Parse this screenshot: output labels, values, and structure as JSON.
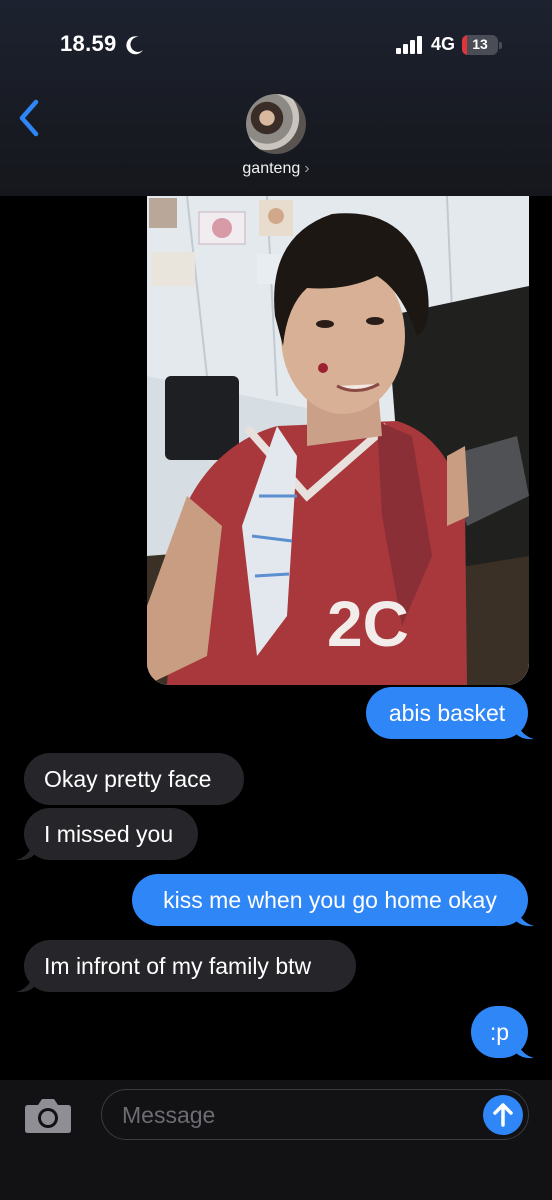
{
  "status": {
    "time": "18.59",
    "network": "4G",
    "battery": "13",
    "battery_level": 0.13
  },
  "contact": {
    "name": "ganteng",
    "chevron": "›"
  },
  "icons": {
    "back": "chevron-left-icon",
    "moon": "moon-icon",
    "camera": "camera-icon",
    "send": "arrow-up-icon"
  },
  "messages": [
    {
      "from": "me",
      "text": "abis basket"
    },
    {
      "from": "them",
      "text": "Okay pretty face"
    },
    {
      "from": "them",
      "text": "I missed you"
    },
    {
      "from": "me",
      "text": "kiss me when you go home okay"
    },
    {
      "from": "them",
      "text": "Im infront of my family btw"
    },
    {
      "from": "me",
      "text": ":p"
    }
  ],
  "composer": {
    "placeholder": "Message"
  },
  "colors": {
    "sent_bubble": "#2f86f6",
    "received_bubble": "#26262a",
    "accent": "#2f86f6",
    "battery_low": "#e0353b"
  }
}
